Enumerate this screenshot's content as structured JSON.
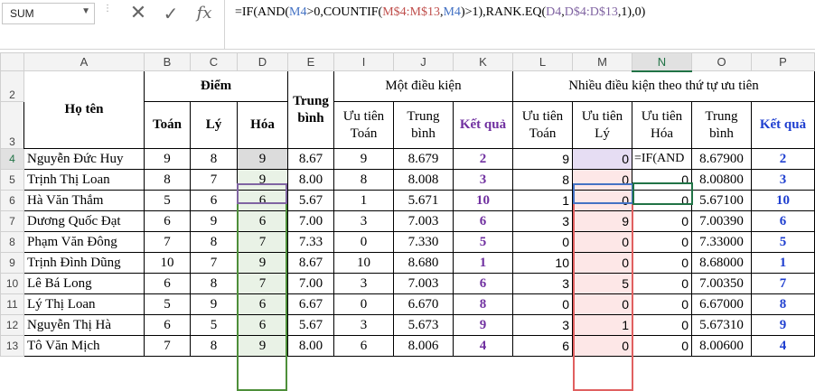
{
  "formula_bar": {
    "name_box": "SUM",
    "cancel_icon": "close-icon",
    "enter_icon": "check-icon",
    "fx_label": "fx",
    "formula": {
      "p1": "=IF(AND(",
      "r1": "M4",
      "p2": ">0,COUNTIF(",
      "r2": "M$4:M$13",
      "p3": ",",
      "r3": "M4",
      "p4": ")>1),RANK.EQ(",
      "r4": "D4",
      "p5": ",",
      "r5": "D$4:D$13",
      "p6": ",1),0)"
    }
  },
  "columns": [
    "A",
    "B",
    "C",
    "D",
    "E",
    "I",
    "J",
    "K",
    "L",
    "M",
    "N",
    "O",
    "P"
  ],
  "row_numbers": [
    "2",
    "3",
    "4",
    "5",
    "6",
    "7",
    "8",
    "9",
    "10",
    "11",
    "12",
    "13"
  ],
  "headers": {
    "ho_ten": "Họ tên",
    "diem": "Điểm",
    "toan": "Toán",
    "ly": "Lý",
    "hoa": "Hóa",
    "trung_binh_bold": "Trung bình",
    "mot_dieu_kien": "Một điều kiện",
    "uu_tien_toan": "Ưu tiên Toán",
    "trung_binh": "Trung bình",
    "ket_qua": "Kết quả",
    "nhieu_dieu_kien": "Nhiều điều kiện theo thứ tự ưu tiên",
    "uu_tien_toan2": "Ưu tiên Toán",
    "uu_tien_ly": "Ưu tiên Lý",
    "uu_tien_hoa": "Ưu tiên Hóa",
    "trung_binh2": "Trung bình",
    "ket_qua2": "Kết quả"
  },
  "rows": [
    {
      "name": "Nguyễn Đức Huy",
      "toan": "9",
      "ly": "8",
      "hoa": "9",
      "tb": "8.67",
      "ut_toan": "9",
      "tb1": "8.679",
      "kq1": "2",
      "l": "9",
      "m": "0",
      "n": "=IF(AND",
      "o": "8.67900",
      "p": "2"
    },
    {
      "name": "Trịnh Thị Loan",
      "toan": "8",
      "ly": "7",
      "hoa": "9",
      "tb": "8.00",
      "ut_toan": "8",
      "tb1": "8.008",
      "kq1": "3",
      "l": "8",
      "m": "0",
      "n": "0",
      "o": "8.00800",
      "p": "3"
    },
    {
      "name": "Hà Văn Thắm",
      "toan": "5",
      "ly": "6",
      "hoa": "6",
      "tb": "5.67",
      "ut_toan": "1",
      "tb1": "5.671",
      "kq1": "10",
      "l": "1",
      "m": "0",
      "n": "0",
      "o": "5.67100",
      "p": "10"
    },
    {
      "name": "Dương Quốc Đạt",
      "toan": "6",
      "ly": "9",
      "hoa": "6",
      "tb": "7.00",
      "ut_toan": "3",
      "tb1": "7.003",
      "kq1": "6",
      "l": "3",
      "m": "9",
      "n": "0",
      "o": "7.00390",
      "p": "6"
    },
    {
      "name": "Phạm Văn Đông",
      "toan": "7",
      "ly": "8",
      "hoa": "7",
      "tb": "7.33",
      "ut_toan": "0",
      "tb1": "7.330",
      "kq1": "5",
      "l": "0",
      "m": "0",
      "n": "0",
      "o": "7.33000",
      "p": "5"
    },
    {
      "name": "Trịnh Đình Dũng",
      "toan": "10",
      "ly": "7",
      "hoa": "9",
      "tb": "8.67",
      "ut_toan": "10",
      "tb1": "8.680",
      "kq1": "1",
      "l": "10",
      "m": "0",
      "n": "0",
      "o": "8.68000",
      "p": "1"
    },
    {
      "name": "Lê Bá Long",
      "toan": "6",
      "ly": "8",
      "hoa": "7",
      "tb": "7.00",
      "ut_toan": "3",
      "tb1": "7.003",
      "kq1": "6",
      "l": "3",
      "m": "5",
      "n": "0",
      "o": "7.00350",
      "p": "7"
    },
    {
      "name": "Lý Thị Loan",
      "toan": "5",
      "ly": "9",
      "hoa": "6",
      "tb": "6.67",
      "ut_toan": "0",
      "tb1": "6.670",
      "kq1": "8",
      "l": "0",
      "m": "0",
      "n": "0",
      "o": "6.67000",
      "p": "8"
    },
    {
      "name": "Nguyễn Thị Hà",
      "toan": "6",
      "ly": "5",
      "hoa": "6",
      "tb": "5.67",
      "ut_toan": "3",
      "tb1": "5.673",
      "kq1": "9",
      "l": "3",
      "m": "1",
      "n": "0",
      "o": "5.67310",
      "p": "9"
    },
    {
      "name": "Tô Văn Mịch",
      "toan": "7",
      "ly": "8",
      "hoa": "9",
      "tb": "8.00",
      "ut_toan": "6",
      "tb1": "8.006",
      "kq1": "4",
      "l": "6",
      "m": "0",
      "n": "0",
      "o": "8.00600",
      "p": "4"
    }
  ]
}
